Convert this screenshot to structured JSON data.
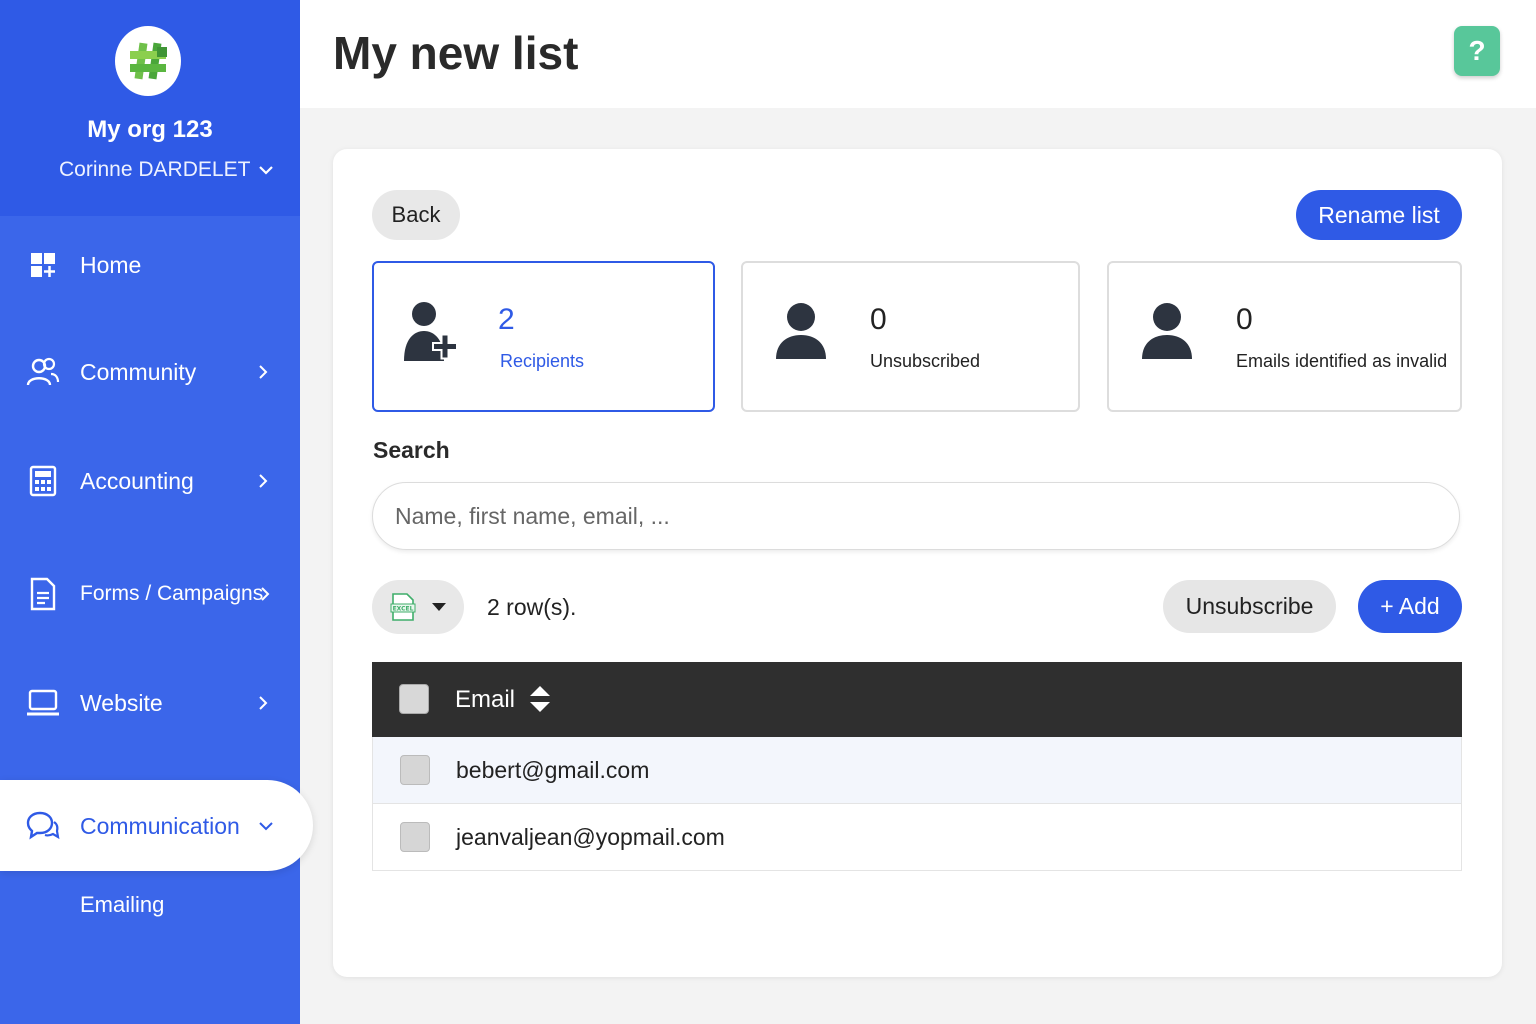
{
  "sidebar": {
    "org_name": "My org 123",
    "user_name": "Corinne DARDELET",
    "accent": "#2f5ae6",
    "items": [
      {
        "label": "Home",
        "icon": "dashboard-icon"
      },
      {
        "label": "Community",
        "icon": "users-icon"
      },
      {
        "label": "Accounting",
        "icon": "calculator-icon"
      },
      {
        "label": "Forms / Campaigns",
        "icon": "document-icon"
      },
      {
        "label": "Website",
        "icon": "laptop-icon"
      },
      {
        "label": "Communication",
        "icon": "chat-bubbles-icon"
      }
    ],
    "sub_items": [
      {
        "label": "Emailing"
      }
    ]
  },
  "header": {
    "title": "My new list",
    "help_label": "?"
  },
  "toolbar": {
    "back_label": "Back",
    "rename_label": "Rename list"
  },
  "stats": [
    {
      "value": "2",
      "label": "Recipients",
      "icon": "add-user-icon"
    },
    {
      "value": "0",
      "label": "Unsubscribed",
      "icon": "user-icon"
    },
    {
      "value": "0",
      "label": "Emails identified as invalid",
      "icon": "user-icon"
    }
  ],
  "search": {
    "label": "Search",
    "placeholder": "Name, first name, email, ...",
    "value": ""
  },
  "actions": {
    "row_count": "2 row(s).",
    "unsubscribe_label": "Unsubscribe",
    "add_label": "+ Add",
    "export_icon": "excel-icon",
    "export_icon_text": "EXCEL"
  },
  "table": {
    "columns": [
      "Email"
    ],
    "rows": [
      {
        "email": "bebert@gmail.com"
      },
      {
        "email": "jeanvaljean@yopmail.com"
      }
    ]
  }
}
